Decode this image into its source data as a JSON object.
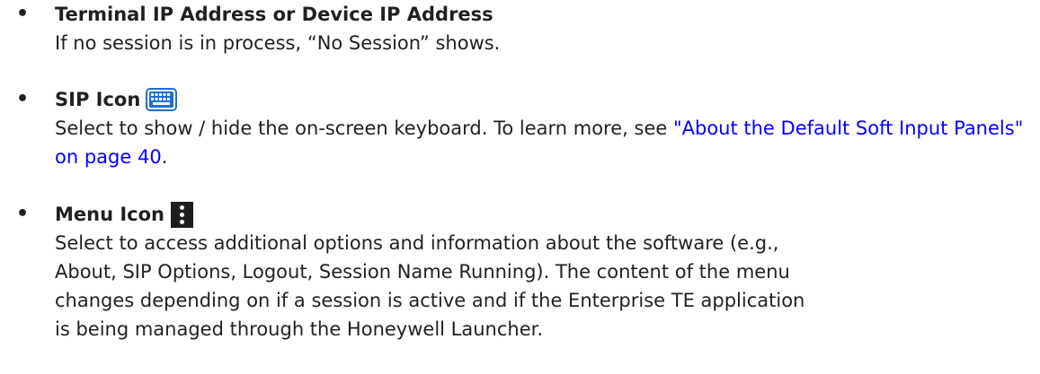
{
  "items": [
    {
      "bullet": "•",
      "title": "Terminal IP Address or Device IP Address",
      "lines": [
        "If no session is in process, “No Session” shows."
      ]
    },
    {
      "bullet": "•",
      "title": "SIP Icon",
      "icon": "keyboard-icon",
      "desc_before": "Select to show / hide the on-screen keyboard. To learn more, see ",
      "link_text": "\"About the Default Soft Input Panels\" on page 40",
      "desc_after": "."
    },
    {
      "bullet": "•",
      "title": "Menu Icon",
      "icon": "vertical-ellipsis-icon",
      "lines": [
        "Select to access additional options and information about the software (e.g.,",
        "About, SIP Options, Logout, Session Name Running). The content of the menu",
        "changes depending on if a session is active and if the Enterprise TE application",
        "is being managed through the Honeywell Launcher."
      ]
    }
  ],
  "colors": {
    "text": "#231f20",
    "link": "#0000ff",
    "icon_blue": "#1f6fd0",
    "menu_icon_bg": "#1e1e1e"
  }
}
